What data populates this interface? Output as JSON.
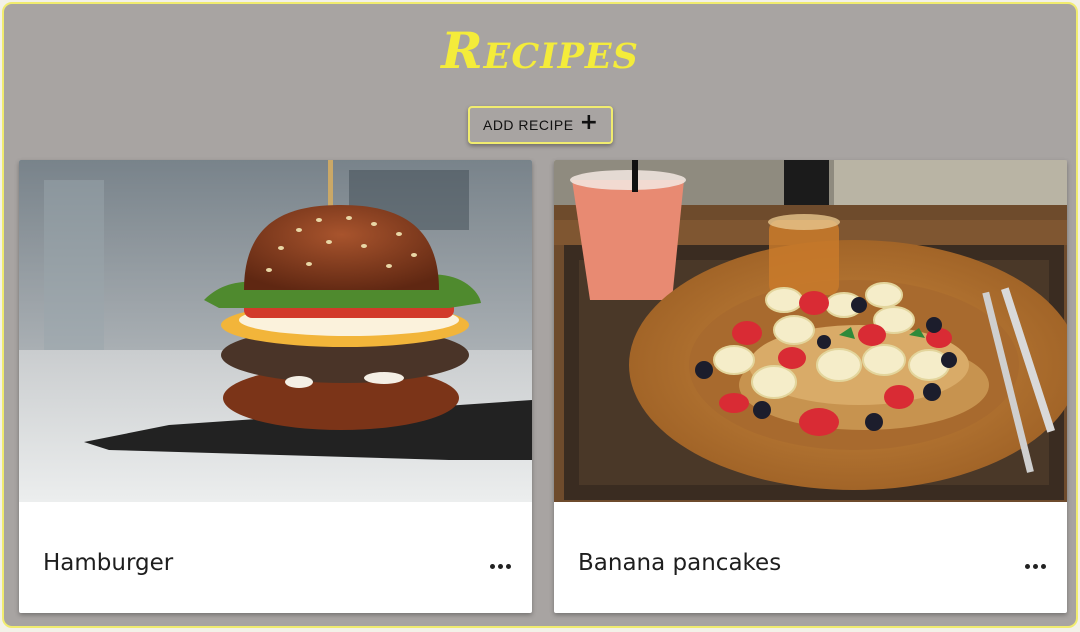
{
  "header": {
    "title": "Recipes",
    "add_button_label": "ADD RECIPE"
  },
  "recipes": [
    {
      "name": "Hamburger",
      "image": "hamburger-photo",
      "menu_icon": "more-horizontal-icon"
    },
    {
      "name": "Banana pancakes",
      "image": "banana-pancakes-photo",
      "menu_icon": "more-horizontal-icon"
    }
  ],
  "colors": {
    "background": "#a8a4a2",
    "accent": "#f4ec3a",
    "border": "#f1ec6f",
    "card": "#ffffff"
  }
}
